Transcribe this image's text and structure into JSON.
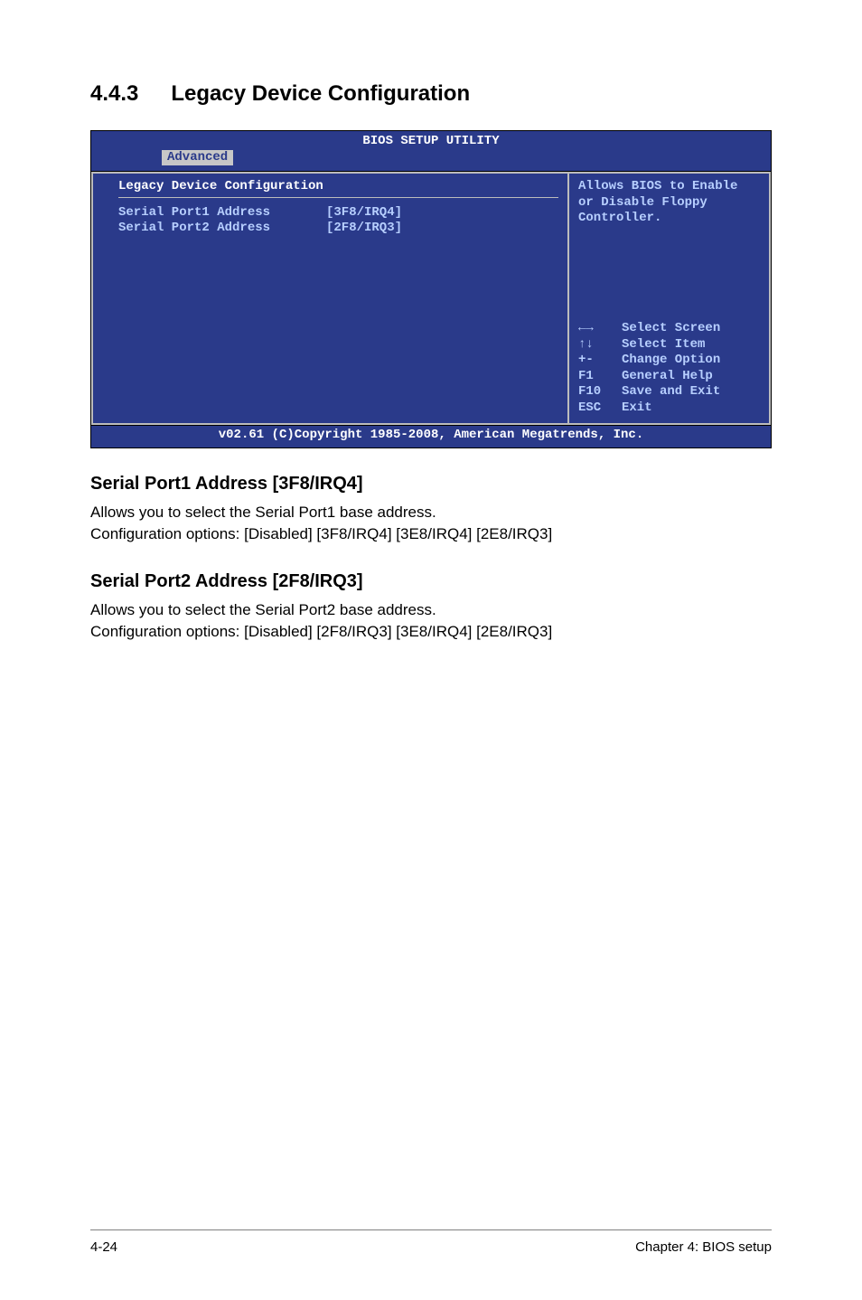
{
  "section": {
    "number": "4.4.3",
    "title": "Legacy Device Configuration"
  },
  "bios": {
    "title": "BIOS SETUP UTILITY",
    "tab": "Advanced",
    "panel_heading": "Legacy Device Configuration",
    "rows": [
      {
        "label": "Serial Port1 Address",
        "value": "[3F8/IRQ4]"
      },
      {
        "label": "Serial Port2 Address",
        "value": "[2F8/IRQ3]"
      }
    ],
    "help": {
      "line1": "Allows BIOS to Enable",
      "line2": "or Disable Floppy",
      "line3": "Controller."
    },
    "nav": [
      {
        "key": "←→",
        "action": "Select Screen"
      },
      {
        "key": "↑↓",
        "action": "Select Item"
      },
      {
        "key": "+-",
        "action": "Change Option"
      },
      {
        "key": "F1",
        "action": "General Help"
      },
      {
        "key": "F10",
        "action": "Save and Exit"
      },
      {
        "key": "ESC",
        "action": "Exit"
      }
    ],
    "footer": "v02.61 (C)Copyright 1985-2008, American Megatrends, Inc."
  },
  "body": {
    "h1": "Serial Port1 Address [3F8/IRQ4]",
    "p1a": "Allows you to select the Serial Port1 base address.",
    "p1b": "Configuration options: [Disabled] [3F8/IRQ4] [3E8/IRQ4] [2E8/IRQ3]",
    "h2": "Serial Port2 Address [2F8/IRQ3]",
    "p2a": "Allows you to select the Serial Port2 base address.",
    "p2b": "Configuration options: [Disabled] [2F8/IRQ3] [3E8/IRQ4] [2E8/IRQ3]"
  },
  "footer": {
    "left": "4-24",
    "right": "Chapter 4: BIOS setup"
  }
}
